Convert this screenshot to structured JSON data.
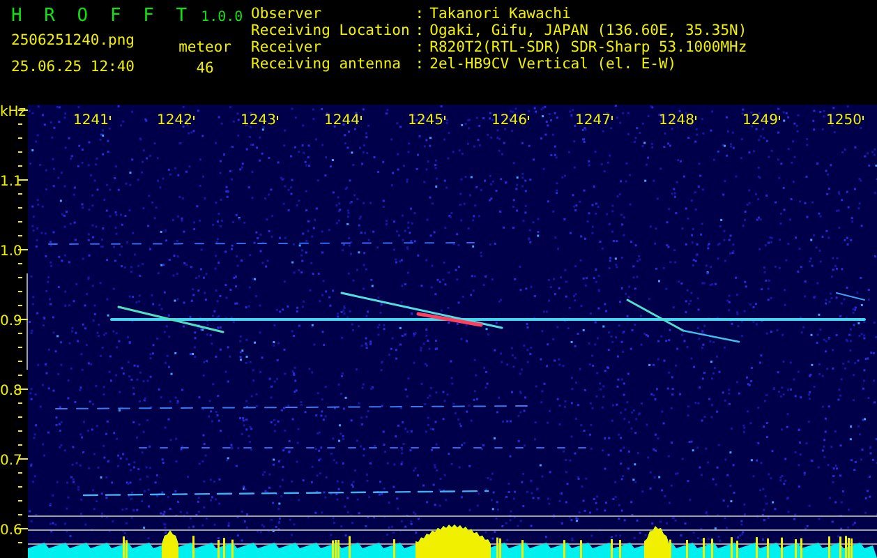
{
  "header": {
    "app_name": "H R O F F T",
    "version": "1.0.0",
    "filename": "2506251240.png",
    "datetime": "25.06.25 12:40",
    "count_label": "meteor",
    "count": "46",
    "info": [
      {
        "label": "Observer",
        "separator": ":",
        "value": "Takanori Kawachi"
      },
      {
        "label": "Receiving Location",
        "separator": ":",
        "value": "Ogaki, Gifu, JAPAN (136.60E, 35.35N)"
      },
      {
        "label": "Receiver",
        "separator": ":",
        "value": "R820T2(RTL-SDR) SDR-Sharp 53.1000MHz"
      },
      {
        "label": "Receiving antenna",
        "separator": ":",
        "value": "2el-HB9CV Vertical (el. E-W)"
      }
    ]
  },
  "spectrogram": {
    "unit": "kHz",
    "x_ticks": [
      "1241",
      "1242",
      "1243",
      "1244",
      "1245",
      "1246",
      "1247",
      "1248",
      "1249",
      "1250"
    ],
    "y_ticks": [
      "1.1",
      "1.0",
      "0.9",
      "0.8",
      "0.7",
      "0.6"
    ]
  }
}
